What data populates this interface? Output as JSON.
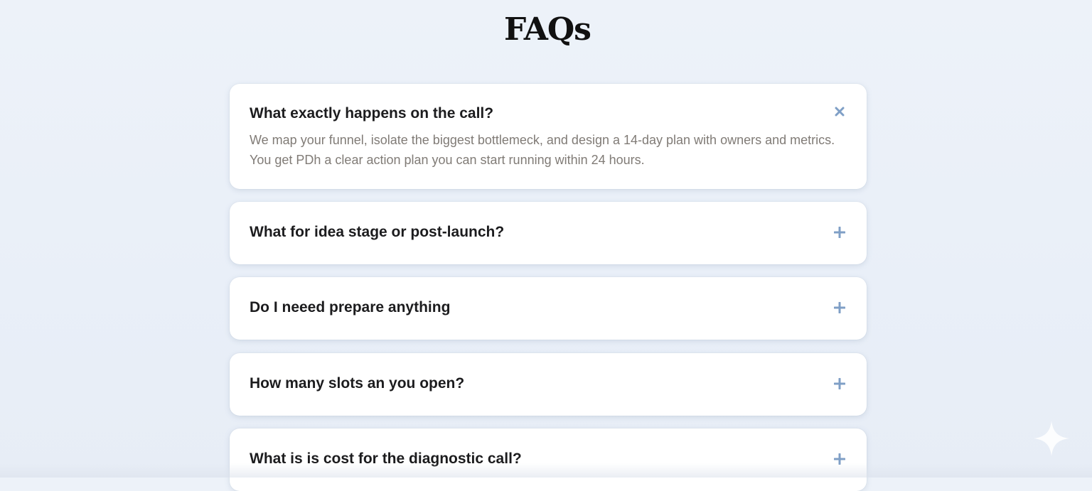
{
  "page": {
    "title": "FAQs"
  },
  "faqs": [
    {
      "question": "What exactly happens on the call?",
      "answer": "We map your funnel, isolate the biggest bottlemeck, and design a 14-day plan with owners and metrics. You get PDh a clear action plan you can start running within 24 hours.",
      "state": "expanded",
      "icon": "close-icon"
    },
    {
      "question": "What for idea stage or post-launch?",
      "state": "collapsed",
      "icon": "plus-icon"
    },
    {
      "question": "Do I neeed prepare anything",
      "state": "collapsed",
      "icon": "plus-icon"
    },
    {
      "question": "How many slots an you open?",
      "state": "collapsed",
      "icon": "plus-icon"
    },
    {
      "question": "What is is cost for the diagnostic call?",
      "state": "collapsed",
      "icon": "plus-icon"
    }
  ],
  "colors": {
    "background": "#ebf0f8",
    "card": "#ffffff",
    "question_text": "#1c1c1e",
    "answer_text": "#807b76",
    "icon_accent": "#7f9fc6"
  }
}
